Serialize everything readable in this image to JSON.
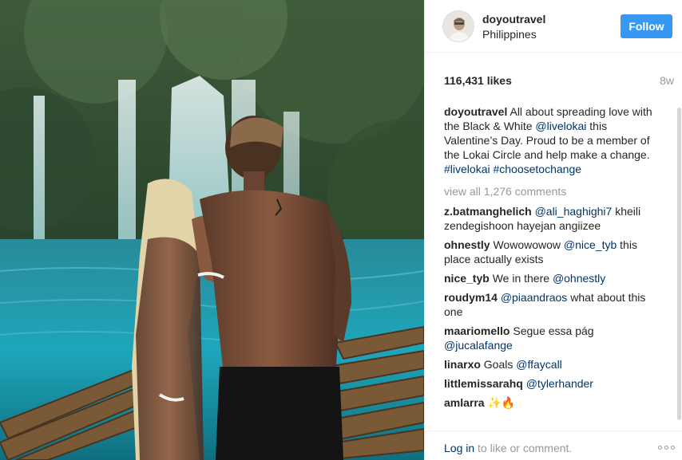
{
  "post": {
    "username": "doyoutravel",
    "location": "Philippines",
    "follow_label": "Follow",
    "likes": "116,431 likes",
    "time": "8w",
    "caption": {
      "username": "doyoutravel",
      "p1": "All about spreading love with the Black & White ",
      "m1": "@livelokai",
      "p2": " this Valentine’s Day. Proud to be a member of the Lokai Circle and help make a change. ",
      "h1": "#livelokai",
      "h2": "#choosetochange"
    },
    "view_all": "view all 1,276 comments",
    "comments": [
      {
        "user": "z.batmanghelich",
        "mention": "@ali_haghighi7",
        "text": " kheili zendegishoon hayejan angiizee"
      },
      {
        "user": "ohnestly",
        "pre": "Wowowowow ",
        "mention": "@nice_tyb",
        "text": " this place actually exists"
      },
      {
        "user": "nice_tyb",
        "pre": "We in there ",
        "mention": "@ohnestly"
      },
      {
        "user": "roudym14",
        "mention": "@piaandraos",
        "text": " what about this one"
      },
      {
        "user": "maariomello",
        "pre": "Segue essa pág ",
        "mention": "@jucalafange"
      },
      {
        "user": "linarxo",
        "pre": "Goals ",
        "mention": "@ffaycall"
      },
      {
        "user": "littlemissarahq",
        "mention": "@tylerhander"
      },
      {
        "user": "amlarra",
        "text": "✨🔥"
      }
    ],
    "login_link": "Log in",
    "login_rest": " to like or comment."
  },
  "icons": {
    "more": "more-options-icon"
  },
  "colors": {
    "accent": "#3897f0",
    "link": "#003569",
    "muted": "#999999"
  }
}
